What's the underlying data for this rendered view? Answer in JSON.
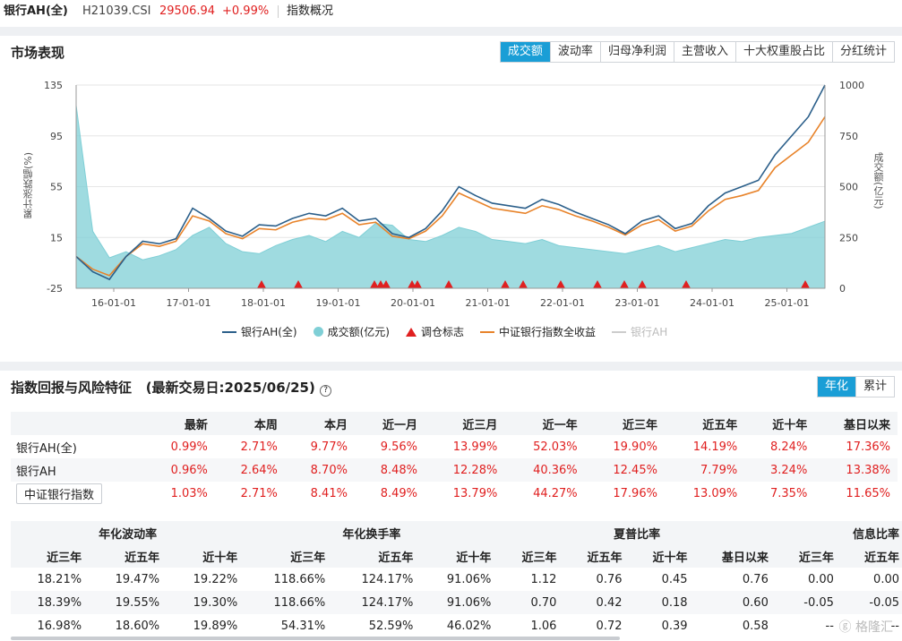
{
  "header": {
    "name": "银行AH(全)",
    "code": "H21039.CSI",
    "price": "29506.94",
    "change": "+0.99%",
    "link": "指数概况"
  },
  "market": {
    "title": "市场表现",
    "tabs": [
      "成交额",
      "波动率",
      "归母净利润",
      "主营收入",
      "十大权重股占比",
      "分红统计"
    ],
    "active_tab": 0
  },
  "chart_data": {
    "type": "line",
    "ylabel_left": "累计涨跌幅(%)",
    "ylabel_right": "成交额(亿元)",
    "left_ticks": [
      "135",
      "95",
      "55",
      "15",
      "-25"
    ],
    "right_ticks": [
      "1000",
      "750",
      "500",
      "250",
      "0"
    ],
    "ylim_left": [
      -25,
      135
    ],
    "ylim_right": [
      0,
      1000
    ],
    "x_ticks": [
      "16-01-01",
      "17-01-01",
      "18-01-01",
      "19-01-01",
      "20-01-01",
      "21-01-01",
      "22-01-01",
      "23-01-01",
      "24-01-01",
      "25-01-01"
    ],
    "series": [
      {
        "name": "银行AH(全)",
        "color": "#2b5f8a",
        "values": [
          0,
          -12,
          -18,
          0,
          12,
          10,
          14,
          38,
          30,
          20,
          16,
          25,
          24,
          30,
          34,
          32,
          38,
          28,
          30,
          18,
          15,
          22,
          36,
          55,
          48,
          42,
          40,
          38,
          45,
          41,
          35,
          30,
          25,
          18,
          28,
          32,
          22,
          26,
          40,
          50,
          55,
          60,
          80,
          95,
          110,
          135
        ]
      },
      {
        "name": "中证银行指数全收益",
        "color": "#e8832a",
        "values": [
          0,
          -10,
          -15,
          0,
          10,
          8,
          12,
          32,
          28,
          18,
          14,
          22,
          21,
          27,
          30,
          29,
          34,
          25,
          27,
          16,
          14,
          20,
          32,
          50,
          44,
          38,
          36,
          34,
          40,
          37,
          32,
          28,
          23,
          17,
          25,
          29,
          20,
          24,
          36,
          45,
          48,
          52,
          70,
          80,
          90,
          110
        ]
      },
      {
        "name": "成交额(亿元)",
        "color": "#7fcfd6",
        "values": [
          900,
          280,
          150,
          180,
          140,
          160,
          190,
          260,
          300,
          220,
          180,
          170,
          210,
          240,
          260,
          230,
          280,
          250,
          320,
          310,
          240,
          230,
          260,
          300,
          280,
          240,
          230,
          220,
          240,
          210,
          200,
          190,
          180,
          170,
          190,
          210,
          180,
          200,
          220,
          240,
          230,
          250,
          260,
          270,
          300,
          330
        ]
      }
    ],
    "rebalance_marks": 16,
    "legend": [
      "银行AH(全)",
      "成交额(亿元)",
      "调仓标志",
      "中证银行指数全收益",
      "银行AH"
    ]
  },
  "returns": {
    "title": "指数回报与风险特征",
    "date_label": "(最新交易日:2025/06/25)",
    "mode_tabs": [
      "年化",
      "累计"
    ],
    "columns": [
      "最新",
      "本周",
      "本月",
      "近一月",
      "近三月",
      "近一年",
      "近三年",
      "近五年",
      "近十年",
      "基日以来"
    ],
    "rows": [
      {
        "name": "银行AH(全)",
        "values": [
          "0.99%",
          "2.71%",
          "9.77%",
          "9.56%",
          "13.99%",
          "52.03%",
          "19.90%",
          "14.19%",
          "8.24%",
          "17.36%"
        ]
      },
      {
        "name": "银行AH",
        "values": [
          "0.96%",
          "2.64%",
          "8.70%",
          "8.48%",
          "12.28%",
          "40.36%",
          "12.45%",
          "7.79%",
          "3.24%",
          "13.38%"
        ]
      },
      {
        "name": "中证银行指数",
        "values": [
          "1.03%",
          "2.71%",
          "8.41%",
          "8.49%",
          "13.79%",
          "44.27%",
          "17.96%",
          "13.09%",
          "7.35%",
          "11.65%"
        ]
      }
    ]
  },
  "risk": {
    "groups": [
      "年化波动率",
      "年化换手率",
      "夏普比率",
      "信息比率"
    ],
    "subcols": [
      "近三年",
      "近五年",
      "近十年",
      "近三年",
      "近五年",
      "近十年",
      "近三年",
      "近五年",
      "近十年",
      "基日以来",
      "近三年",
      "近五年"
    ],
    "rows": [
      [
        "18.21%",
        "19.47%",
        "19.22%",
        "118.66%",
        "124.17%",
        "91.06%",
        "1.12",
        "0.76",
        "0.45",
        "0.76",
        "0.00",
        "0.00"
      ],
      [
        "18.39%",
        "19.55%",
        "19.30%",
        "118.66%",
        "124.17%",
        "91.06%",
        "0.70",
        "0.42",
        "0.18",
        "0.60",
        "-0.05",
        "-0.05"
      ],
      [
        "16.98%",
        "18.60%",
        "19.89%",
        "54.31%",
        "52.59%",
        "46.02%",
        "1.06",
        "0.72",
        "0.39",
        "0.58",
        "--",
        "--"
      ]
    ]
  },
  "watermark": "格隆汇"
}
